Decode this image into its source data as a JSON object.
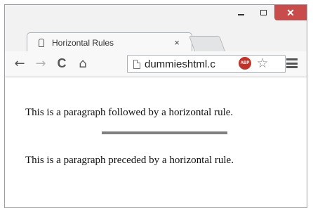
{
  "window": {
    "minimize_label": "minimize",
    "maximize_label": "maximize",
    "close_glyph": "✕"
  },
  "tab": {
    "title": "Horizontal Rules",
    "close_glyph": "×",
    "icon": "page-favicon-icon"
  },
  "toolbar": {
    "back_glyph": "←",
    "forward_glyph": "→",
    "reload_glyph": "C",
    "home_glyph": "⌂",
    "url": "dummieshtml.c",
    "adblock_label": "ABP",
    "star_glyph": "☆",
    "menu_icon": "hamburger-menu-icon"
  },
  "content": {
    "paragraph_1": "This is a paragraph followed by a horizontal rule.",
    "paragraph_2": "This is a paragraph preceded by a horizontal rule.",
    "hr_color": "#808080"
  },
  "colors": {
    "close_button": "#c94c4c",
    "chrome_bg": "#f2f2f2",
    "adblock_red": "#c0332b"
  }
}
